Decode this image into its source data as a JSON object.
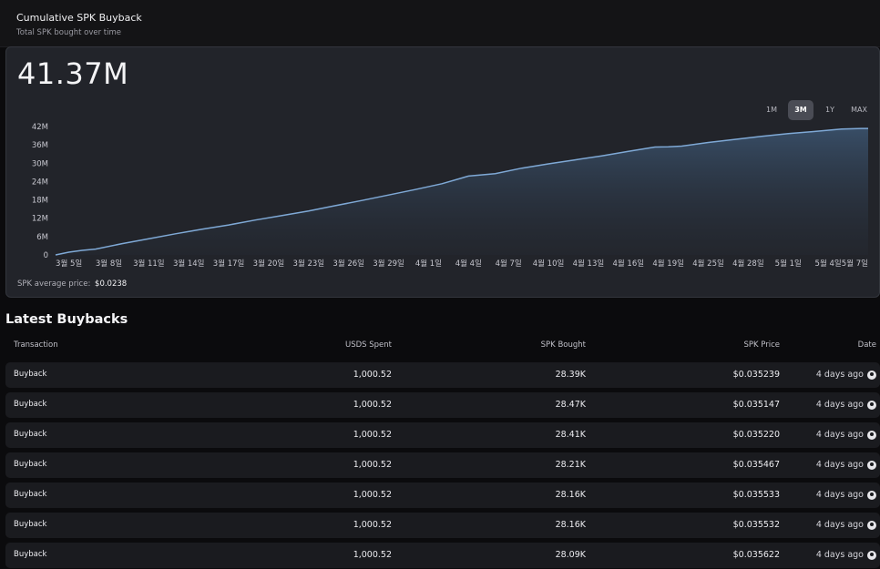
{
  "card": {
    "title": "Cumulative SPK Buyback",
    "subtitle": "Total SPK bought over time"
  },
  "chart_header": {
    "total": "41.37M",
    "ranges": [
      "1M",
      "3M",
      "1Y",
      "MAX"
    ],
    "active_range": "3M"
  },
  "average_price": {
    "label": "SPK average price:",
    "value": "$0.0238"
  },
  "chart_data": {
    "type": "area",
    "title": "",
    "xlabel": "",
    "ylabel": "",
    "y_unit": "M",
    "ylim": [
      0,
      42
    ],
    "y_ticks": [
      "42M",
      "36M",
      "30M",
      "24M",
      "18M",
      "12M",
      "6M",
      "0"
    ],
    "x_tick_labels": [
      "3월 5일",
      "3월 8일",
      "3월 11일",
      "3월 14일",
      "3월 17일",
      "3월 20일",
      "3월 23일",
      "3월 26일",
      "3월 29일",
      "4월 1일",
      "4월 4일",
      "4월 7일",
      "4월 10일",
      "4월 13일",
      "4월 16일",
      "4월 19일",
      "4월 25일",
      "4월 28일",
      "5월 1일",
      "5월 4일",
      "5월 7일"
    ],
    "x_tick_days": [
      4,
      7,
      10,
      13,
      16,
      19,
      22,
      25,
      28,
      31,
      34,
      37,
      40,
      43,
      46,
      49,
      52,
      55,
      58,
      61,
      63
    ],
    "x_range_days": [
      3,
      64
    ],
    "series": [
      {
        "x_days": [
          3,
          4,
          5,
          6,
          8,
          10,
          12,
          14,
          16,
          18,
          20,
          22,
          24,
          26,
          28,
          30,
          32,
          34,
          36,
          38,
          40,
          42,
          44,
          46,
          48,
          49,
          50,
          52,
          54,
          56,
          58,
          60,
          62,
          63.5,
          64
        ],
        "values": [
          0,
          0.9,
          1.5,
          1.9,
          3.7,
          5.3,
          6.9,
          8.4,
          9.8,
          11.4,
          12.9,
          14.4,
          16.1,
          17.8,
          19.6,
          21.4,
          23.3,
          25.8,
          26.6,
          28.4,
          29.8,
          31.1,
          32.4,
          33.9,
          35.3,
          35.4,
          35.6,
          36.8,
          37.8,
          38.8,
          39.7,
          40.4,
          41.2,
          41.37,
          41.37
        ]
      }
    ],
    "line_color": "#7fa9d6",
    "grid": false
  },
  "latest": {
    "title": "Latest Buybacks",
    "columns": [
      "Transaction",
      "USDS Spent",
      "SPK Bought",
      "SPK Price",
      "Date"
    ],
    "rows": [
      [
        "Buyback",
        "1,000.52",
        "28.39K",
        "$0.035239",
        "4 days ago"
      ],
      [
        "Buyback",
        "1,000.52",
        "28.47K",
        "$0.035147",
        "4 days ago"
      ],
      [
        "Buyback",
        "1,000.52",
        "28.41K",
        "$0.035220",
        "4 days ago"
      ],
      [
        "Buyback",
        "1,000.52",
        "28.21K",
        "$0.035467",
        "4 days ago"
      ],
      [
        "Buyback",
        "1,000.52",
        "28.16K",
        "$0.035533",
        "4 days ago"
      ],
      [
        "Buyback",
        "1,000.52",
        "28.16K",
        "$0.035532",
        "4 days ago"
      ],
      [
        "Buyback",
        "1,000.52",
        "28.09K",
        "$0.035622",
        "4 days ago"
      ]
    ]
  }
}
